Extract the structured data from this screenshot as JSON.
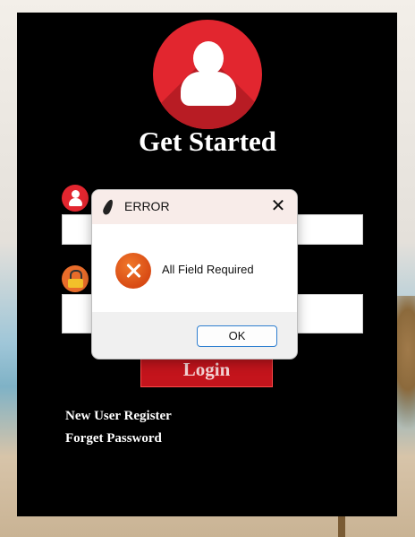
{
  "app": {
    "heading": "Get Started"
  },
  "form": {
    "username_value": "",
    "password_value": "",
    "login_label": "Login",
    "register_link": "New User Register",
    "forget_link": "Forget Password"
  },
  "dialog": {
    "title": "ERROR",
    "close_symbol": "✕",
    "message": "All Field Required",
    "ok_label": "OK",
    "icon": "error-icon"
  },
  "colors": {
    "accent_red": "#e2262f",
    "button_red": "#c4141c",
    "panel_bg": "#000000",
    "error_orange": "#d84a14",
    "ok_border": "#2f7fd0"
  }
}
